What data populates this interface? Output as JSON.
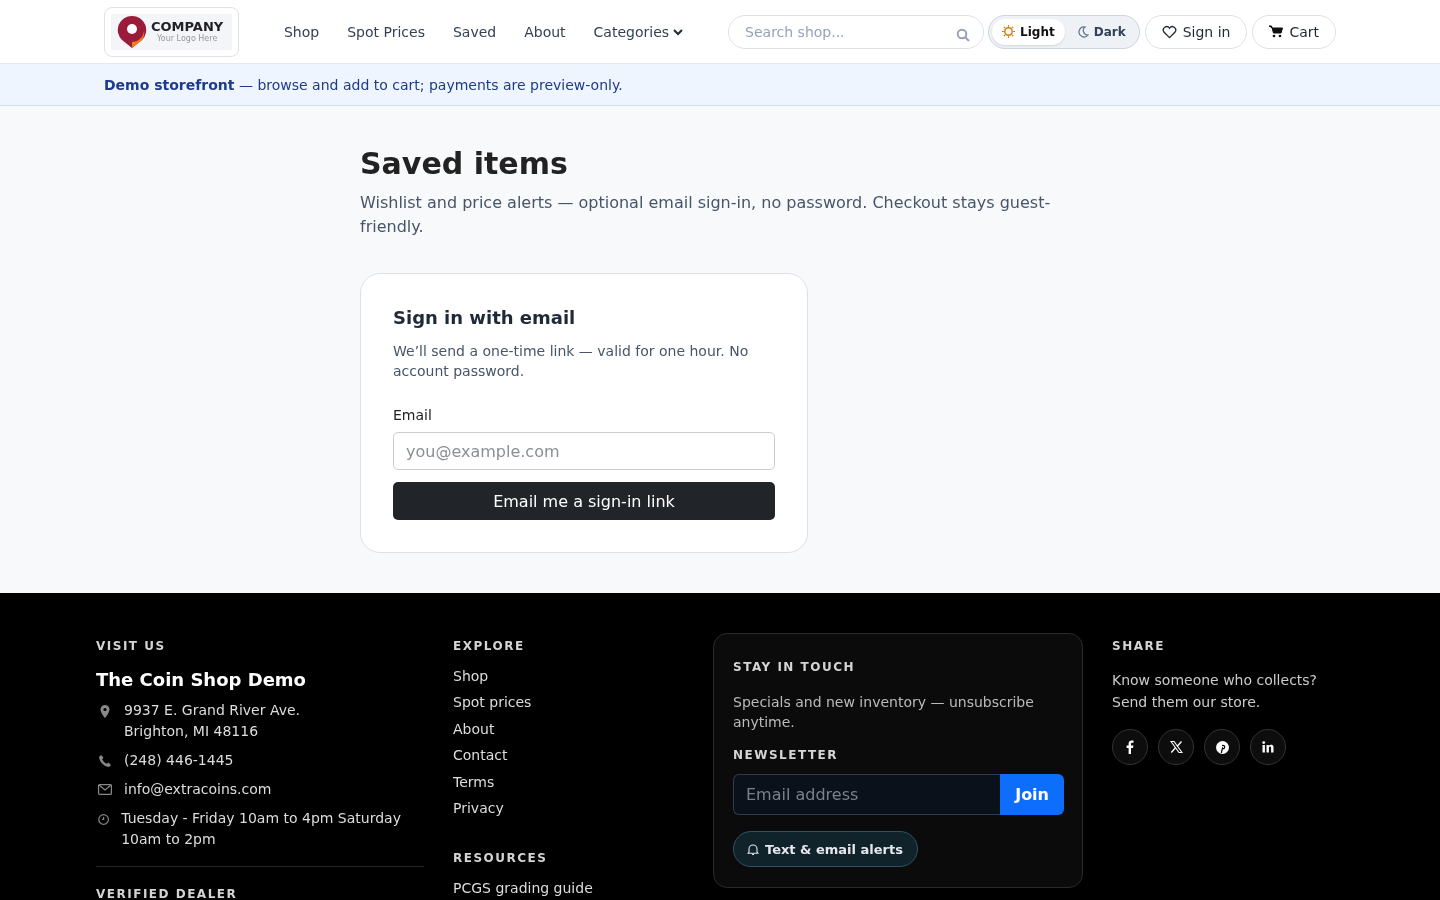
{
  "header": {
    "logo": {
      "name": "COMPANY",
      "tagline": "Your Logo Here"
    },
    "nav": [
      {
        "label": "Shop"
      },
      {
        "label": "Spot Prices"
      },
      {
        "label": "Saved"
      },
      {
        "label": "About"
      },
      {
        "label": "Categories",
        "kind": "dropdown"
      }
    ],
    "search": {
      "placeholder": "Search shop..."
    },
    "theme": [
      {
        "label": "Light",
        "kind": "sun",
        "selected": true
      },
      {
        "label": "Dark",
        "kind": "moon",
        "selected": false
      }
    ],
    "sign_in": "Sign in",
    "cart": "Cart"
  },
  "banner": {
    "strong": "Demo storefront",
    "text": "— browse and add to cart; payments are preview-only."
  },
  "page": {
    "title": "Saved items",
    "subtitle": "Wishlist and price alerts — optional email sign-in, no password. Checkout stays guest-friendly."
  },
  "card": {
    "title": "Sign in with email",
    "text": "We’ll send a one-time link — valid for one hour. No account password.",
    "label": "Email",
    "placeholder": "you@example.com",
    "button": "Email me a sign-in link"
  },
  "footer": {
    "visit": {
      "heading": "VISIT US",
      "name": "The Coin Shop Demo",
      "items": [
        {
          "kind": "pin",
          "lines": [
            "9937 E. Grand River Ave.",
            "Brighton, MI 48116"
          ]
        },
        {
          "kind": "phone",
          "lines": [
            "(248) 446-1445"
          ]
        },
        {
          "kind": "mail",
          "lines": [
            "info@extracoins.com"
          ]
        },
        {
          "kind": "clock",
          "lines": [
            "Tuesday - Friday 10am to 4pm Saturday 10am to 2pm"
          ]
        }
      ],
      "next_heading": "VERIFIED DEALER"
    },
    "explore": {
      "heading": "EXPLORE",
      "links": [
        "Shop",
        "Spot prices",
        "About",
        "Contact",
        "Terms",
        "Privacy"
      ],
      "resources_heading": "RESOURCES",
      "resources": [
        "PCGS grading guide"
      ]
    },
    "touch": {
      "heading": "STAY IN TOUCH",
      "text": "Specials and new inventory — unsubscribe anytime.",
      "newsletter": "NEWSLETTER",
      "placeholder": "Email address",
      "join": "Join",
      "alerts": "Text & email alerts"
    },
    "share": {
      "heading": "SHARE",
      "text": "Know someone who collects? Send them our store.",
      "icons": [
        {
          "kind": "facebook"
        },
        {
          "kind": "x"
        },
        {
          "kind": "pinterest"
        },
        {
          "kind": "linkedin"
        }
      ]
    }
  }
}
